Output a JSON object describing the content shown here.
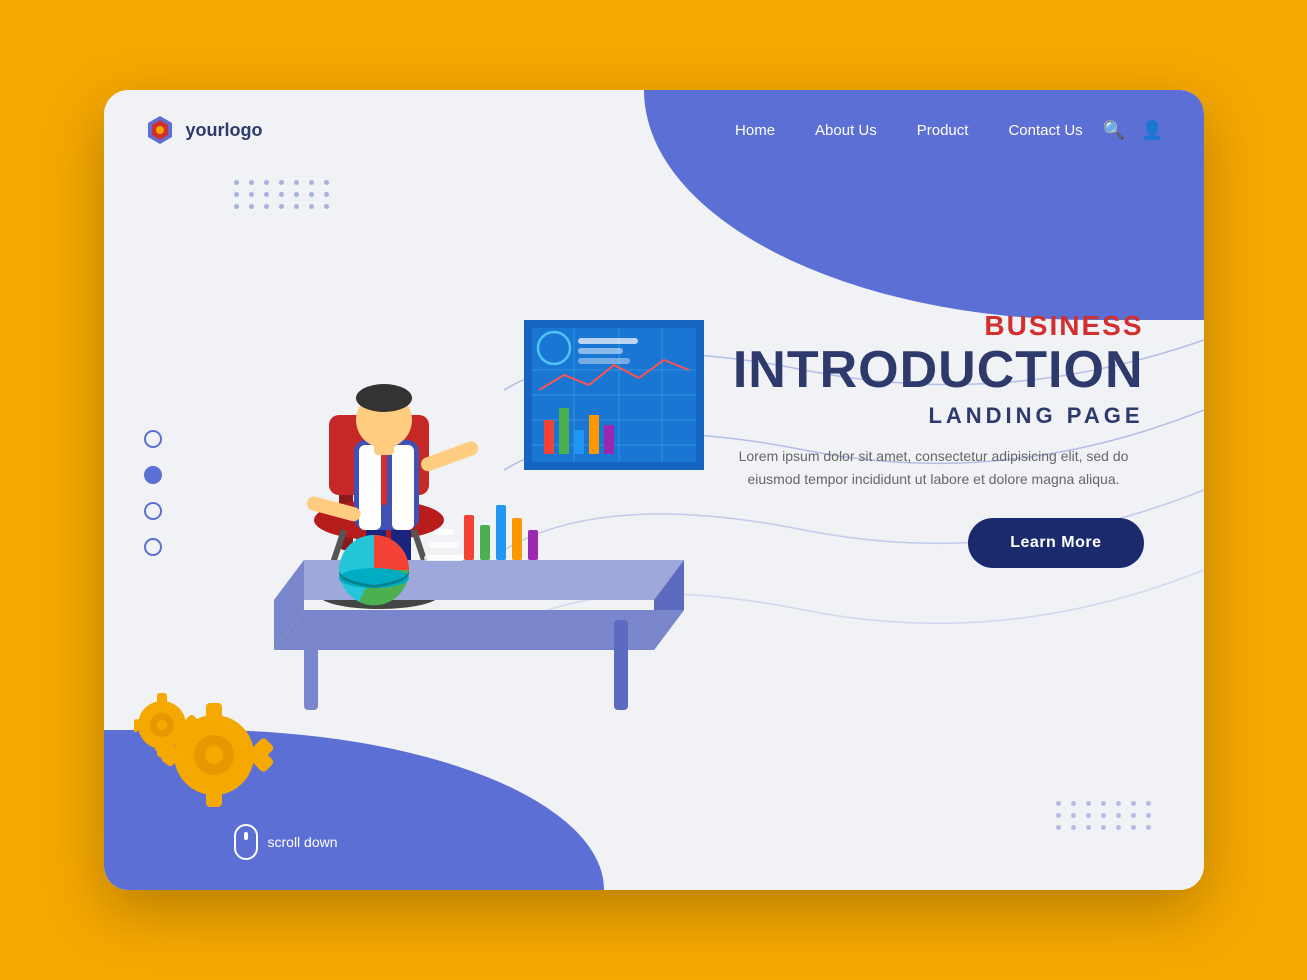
{
  "page": {
    "background_color": "#F5A800",
    "card_background": "#f0f2f5",
    "accent_color": "#5B6FD4",
    "dark_navy": "#1a2a6c"
  },
  "logo": {
    "text": "yourlogo"
  },
  "nav": {
    "links": [
      {
        "label": "Home",
        "id": "home"
      },
      {
        "label": "About Us",
        "id": "about"
      },
      {
        "label": "Product",
        "id": "product"
      },
      {
        "label": "Contact Us",
        "id": "contact"
      }
    ]
  },
  "hero": {
    "business_label": "BUSINESS",
    "title": "INTRODUCTION",
    "subtitle": "LANDING PAGE",
    "description": "Lorem ipsum dolor sit amet, consectetur adipisicing elit,\nsed do eiusmod tempor incididunt ut labore et dolore\nmagna aliqua.",
    "cta_label": "Learn More"
  },
  "scroll": {
    "label": "scroll down"
  },
  "decorations": {
    "dot_color": "#5B6FD4",
    "gear_color": "#F5A800"
  }
}
